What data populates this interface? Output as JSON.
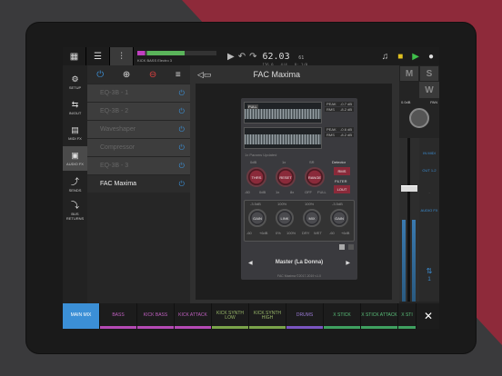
{
  "topbar": {
    "track_name": "KICK BASS Electro 3",
    "time": "62.03",
    "time_sub": "61",
    "tempo": "126.0",
    "signature": "4/4",
    "quantize": "Q: 1/8"
  },
  "sidebar": {
    "items": [
      {
        "label": "SETUP",
        "icon": "gear-icon"
      },
      {
        "label": "IN/OUT",
        "icon": "in-out-icon"
      },
      {
        "label": "MIDI FX",
        "icon": "midi-fx-icon"
      },
      {
        "label": "AUDIO FX",
        "icon": "audio-fx-icon"
      },
      {
        "label": "SENDS",
        "icon": "sends-icon"
      },
      {
        "label": "BUS RETURNS",
        "icon": "returns-icon"
      }
    ]
  },
  "fx_chain": {
    "items": [
      "EQ-3B - 1",
      "EQ-3B - 2",
      "Waveshaper",
      "Compressor",
      "EQ-3B - 3",
      "FAC Maxima"
    ],
    "selected": "FAC Maxima"
  },
  "plugin": {
    "title": "FAC Maxima",
    "peak_label": "FULL",
    "status": "1x Params Updated",
    "readouts": [
      {
        "k": "PEAK",
        "v": "-0.7 dB"
      },
      {
        "k": "RMS",
        "v": "-8.2 dB"
      },
      {
        "k": "PEAK",
        "v": "-0.6 dB"
      },
      {
        "k": "RMS",
        "v": "-8.2 dB"
      }
    ],
    "knobs_top": [
      {
        "label": "THRS",
        "value": "0dB",
        "min": "-60",
        "max": "0dB"
      },
      {
        "label": "RESET",
        "value": "1x",
        "min": "1x",
        "max": "8x"
      },
      {
        "label": "RANGE",
        "value": "SR",
        "min": "OFF",
        "max": "FULL"
      }
    ],
    "detector": "Detector",
    "detector_btn": "RMS",
    "filter": "FILTER",
    "filter_btn": "LOUT",
    "knobs_bottom": [
      {
        "label": "GAIN",
        "value": "-3.5dB",
        "min": "-60",
        "max": "+6dB"
      },
      {
        "label": "LINK",
        "value": "100%",
        "min": "0%",
        "max": "100%"
      },
      {
        "label": "MIX",
        "value": "100%",
        "min": "DRY",
        "max": "WET"
      },
      {
        "label": "GAIN",
        "value": "-3.5dB",
        "min": "-60",
        "max": "+6dB"
      }
    ],
    "preset": "Master (La Donna)",
    "credit": "FAC Maxima ©2017-2019 v1.0"
  },
  "mixer": {
    "mute": "M",
    "solo": "S",
    "w": "W",
    "gain": "0.0dB",
    "pan": "PAN",
    "routing": [
      "IN MIDI",
      "OUT 1-2",
      "AUDIO FX"
    ],
    "counter": "1"
  },
  "tracks": [
    {
      "label": "MAIN MIX",
      "color": "#3b8fd6"
    },
    {
      "label": "BASS",
      "color": "#b54ab5"
    },
    {
      "label": "KICK BASS",
      "color": "#b54ab5"
    },
    {
      "label": "KICK ATTACK",
      "color": "#b54ab5"
    },
    {
      "label": "KICK SYNTH LOW",
      "color": "#7aa34a"
    },
    {
      "label": "KICK SYNTH HIGH",
      "color": "#7aa34a"
    },
    {
      "label": "DRUMS",
      "color": "#7a55c0"
    },
    {
      "label": "X STICK",
      "color": "#3fa060"
    },
    {
      "label": "X STICK ATTACK",
      "color": "#3fa060"
    },
    {
      "label": "X STI",
      "color": "#3fa060"
    }
  ]
}
